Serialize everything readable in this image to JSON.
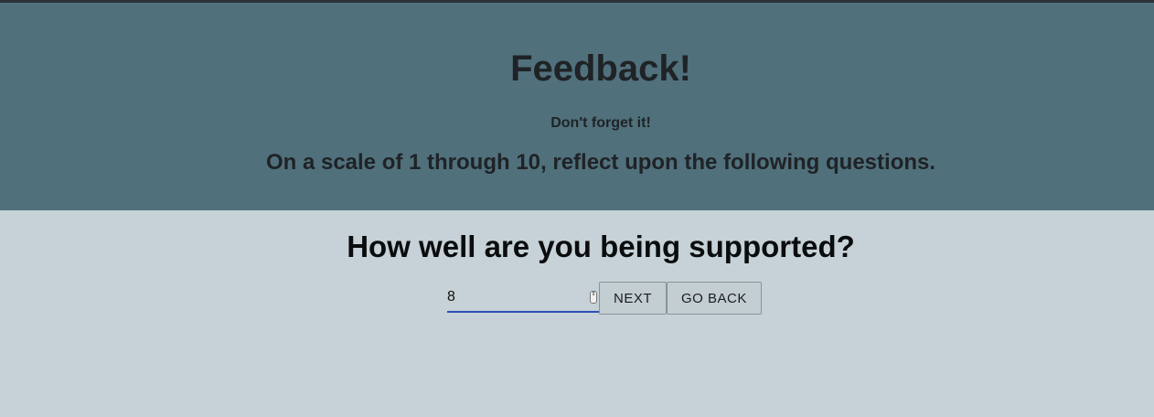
{
  "header": {
    "title": "Feedback!",
    "subtitle": "Don't forget it!",
    "instructions": "On a scale of 1 through 10, reflect upon the following questions."
  },
  "question": {
    "text": "How well are you being supported?",
    "answer_value": "8"
  },
  "buttons": {
    "next_label": "NEXT",
    "back_label": "GO BACK"
  },
  "icons": {
    "spinner": "number-spinner-icon"
  },
  "colors": {
    "header_bg": "#50707c",
    "page_bg": "#c6d2d7",
    "input_underline": "#2f4fb5"
  }
}
